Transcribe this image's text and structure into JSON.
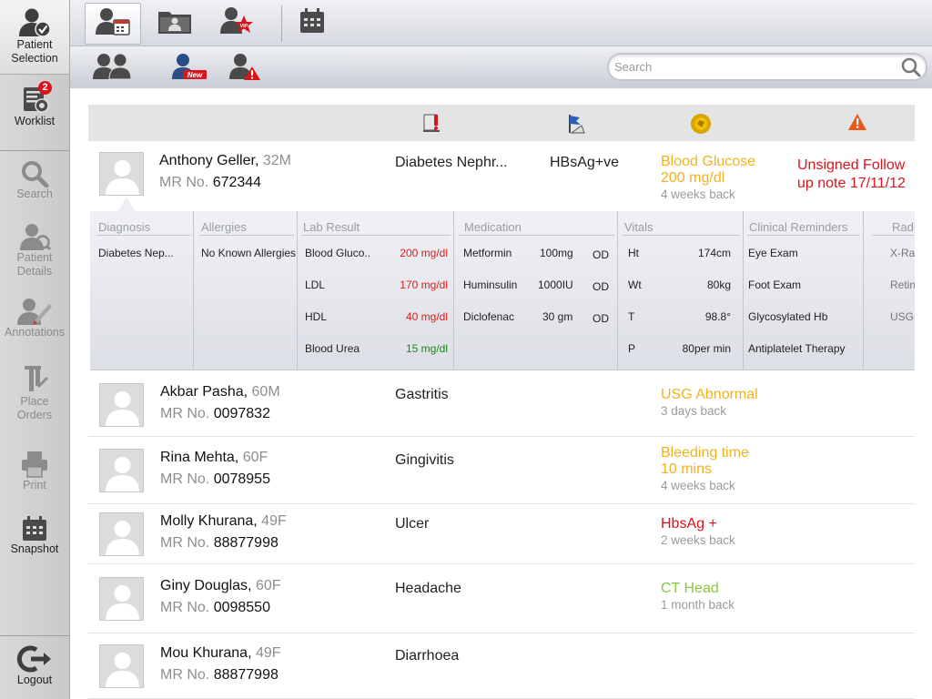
{
  "sidebar": {
    "items": [
      {
        "label": "Patient\nSelection",
        "icon": "patient-selection-icon",
        "state": "active"
      },
      {
        "label": "Worklist",
        "icon": "worklist-icon",
        "badge": "2",
        "state": "enabled"
      },
      {
        "label": "Search",
        "icon": "search-icon",
        "state": "disabled"
      },
      {
        "label": "Patient\nDetails",
        "icon": "patient-details-icon",
        "state": "disabled"
      },
      {
        "label": "Annotations",
        "icon": "annotations-icon",
        "state": "disabled"
      },
      {
        "label": "Place\nOrders",
        "icon": "place-orders-icon",
        "state": "disabled"
      },
      {
        "label": "Print",
        "icon": "print-icon",
        "state": "disabled"
      },
      {
        "label": "Snapshot",
        "icon": "snapshot-icon",
        "state": "enabled"
      },
      {
        "label": "Logout",
        "icon": "logout-icon",
        "state": "enabled"
      }
    ]
  },
  "toolbar": {
    "top": [
      {
        "icon": "my-patients-calendar-icon",
        "selected": true
      },
      {
        "icon": "patient-folder-icon"
      },
      {
        "icon": "vip-patient-icon",
        "badge": "VIP"
      },
      {
        "icon": "calendar-icon"
      }
    ],
    "sub": [
      {
        "icon": "group-patients-icon"
      },
      {
        "icon": "new-patient-icon",
        "badge": "New"
      },
      {
        "icon": "alert-patient-icon"
      }
    ]
  },
  "search": {
    "placeholder": "Search"
  },
  "table_header": {
    "icons": [
      "allergy-alert-icon",
      "infection-flag-icon",
      "lab-result-icon",
      "warning-icon"
    ]
  },
  "patients": [
    {
      "name": "Anthony Geller,",
      "age": "32M",
      "mr_label": "MR No.",
      "mr": "672344",
      "diagnosis": "Diabetes Nephr...",
      "infection": "HBsAg+ve",
      "alert_line1": "Blood Glucose",
      "alert_line2": "200 mg/dl",
      "alert_when": "4 weeks back",
      "alert_color": "#f0b21e",
      "unsigned": "Unsigned Follow up note 17/11/12"
    },
    {
      "name": "Akbar Pasha,",
      "age": "60M",
      "mr_label": "MR No.",
      "mr": "0097832",
      "diagnosis": "Gastritis",
      "alert_line1": "USG Abnormal",
      "alert_line2": "",
      "alert_when": "3 days back",
      "alert_color": "#f0b21e"
    },
    {
      "name": "Rina Mehta,",
      "age": "60F",
      "mr_label": "MR No.",
      "mr": "0078955",
      "diagnosis": "Gingivitis",
      "alert_line1": "Bleeding time",
      "alert_line2": "10 mins",
      "alert_when": "4 weeks back",
      "alert_color": "#f0b21e"
    },
    {
      "name": "Molly Khurana,",
      "age": "49F",
      "mr_label": "MR No.",
      "mr": "88877998",
      "diagnosis": "Ulcer",
      "alert_line1": "HbsAg +",
      "alert_line2": "",
      "alert_when": "2 weeks back",
      "alert_color": "#d9141b"
    },
    {
      "name": "Giny Douglas,",
      "age": "60F",
      "mr_label": "MR No.",
      "mr": "0098550",
      "diagnosis": "Headache",
      "alert_line1": "CT Head",
      "alert_line2": "",
      "alert_when": "1 month back",
      "alert_color": "#8cc63f"
    },
    {
      "name": "Mou Khurana,",
      "age": "49F",
      "mr_label": "MR No.",
      "mr": "88877998",
      "diagnosis": "Diarrhoea",
      "alert_line1": "",
      "alert_line2": "",
      "alert_when": "",
      "alert_color": "#f0b21e"
    }
  ],
  "detail": {
    "headers": {
      "diagnosis": "Diagnosis",
      "allergies": "Allergies",
      "lab": "Lab Result",
      "medication": "Medication",
      "vitals": "Vitals",
      "reminders": "Clinical Reminders",
      "radiology": "Radiology"
    },
    "diagnosis": [
      "Diabetes Nep..."
    ],
    "allergies": [
      "No Known Allergies"
    ],
    "lab": [
      {
        "test": "Blood Gluco..",
        "value": "200 mg/dl",
        "color": "#e01b1b"
      },
      {
        "test": "LDL",
        "value": "170 mg/dl",
        "color": "#e01b1b"
      },
      {
        "test": "HDL",
        "value": "40 mg/dl",
        "color": "#e01b1b"
      },
      {
        "test": "Blood Urea",
        "value": "15 mg/dl",
        "color": "#1a8a1a"
      }
    ],
    "medication": [
      {
        "drug": "Metformin",
        "dose": "100mg",
        "freq": "OD"
      },
      {
        "drug": "Huminsulin",
        "dose": "1000IU",
        "freq": "OD"
      },
      {
        "drug": "Diclofenac",
        "dose": "30 gm",
        "freq": "OD"
      }
    ],
    "vitals": [
      {
        "name": "Ht",
        "value": "174cm"
      },
      {
        "name": "Wt",
        "value": "80kg"
      },
      {
        "name": "T",
        "value": "98.8°"
      },
      {
        "name": "P",
        "value": "80per min"
      }
    ],
    "reminders": [
      "Eye Exam",
      "Foot Exam",
      "Glycosylated Hb",
      "Antiplatelet Therapy"
    ],
    "radiology": [
      "X-Ray",
      "Retina",
      "USG"
    ]
  }
}
